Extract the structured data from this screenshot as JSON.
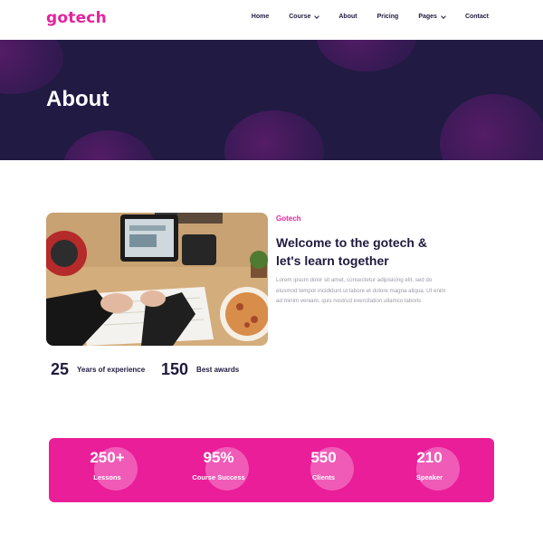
{
  "brand": {
    "logo": "gotech",
    "accent": "#e5239d",
    "dark": "#211a43"
  },
  "nav": {
    "items": [
      {
        "label": "Home",
        "dropdown": false
      },
      {
        "label": "Course",
        "dropdown": true
      },
      {
        "label": "About",
        "dropdown": false
      },
      {
        "label": "Pricing",
        "dropdown": false
      },
      {
        "label": "Pages",
        "dropdown": true
      },
      {
        "label": "Contact",
        "dropdown": false
      }
    ]
  },
  "hero": {
    "title": "About"
  },
  "about": {
    "eyebrow": "Gotech",
    "heading": "Welcome to the gotech & let's learn together",
    "text": "Lorem ipsum dolor sit amet, consectetur adipisicing elit, sed do eiusmod tempor incididunt ut labore et dolore magna aliqua. Ut enim ad minim veniam, quis nostrud exercitation ullamco laboris",
    "stats": [
      {
        "value": "25",
        "label": "Years of experience"
      },
      {
        "value": "150",
        "label": "Best awards"
      }
    ]
  },
  "counters": [
    {
      "value": "250+",
      "label": "Lessons"
    },
    {
      "value": "95%",
      "label": "Course Success"
    },
    {
      "value": "550",
      "label": "Clients"
    },
    {
      "value": "210",
      "label": "Speaker"
    }
  ]
}
